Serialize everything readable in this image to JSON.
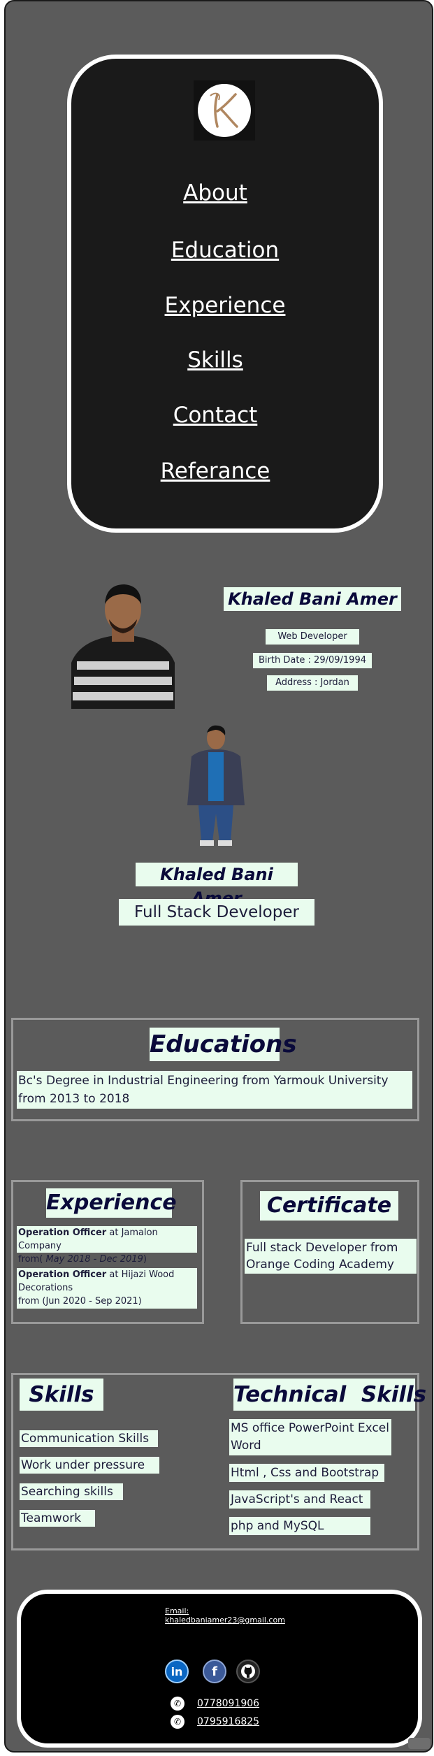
{
  "nav": {
    "items": [
      {
        "label": "About"
      },
      {
        "label": "Education"
      },
      {
        "label": "Experience"
      },
      {
        "label": "Skills"
      },
      {
        "label": "Contact"
      },
      {
        "label": "Referance"
      }
    ]
  },
  "profile": {
    "name": "Khaled Bani Amer",
    "title": "Web Developer",
    "birth": "Birth Date : 29/09/1994",
    "address": "Address : Jordan"
  },
  "hero": {
    "name": "Khaled Bani Amer",
    "role": "Full Stack Developer"
  },
  "education": {
    "heading": "Educations",
    "text": "Bc's Degree in Industrial Engineering from Yarmouk University from 2013 to 2018"
  },
  "experience": {
    "heading": "Experience",
    "jobs": [
      {
        "role": "Operation Officer",
        "company": " at Jamalon Company",
        "dates_prefix": "from(",
        "dates": " May 2018 - Dec 2019",
        "dates_suffix": ")"
      },
      {
        "role": "Operation Officer",
        "company": " at Hijazi Wood Decorations",
        "dates_prefix": "from (Jun 2020 - Sep 2021)",
        "dates": "",
        "dates_suffix": ""
      }
    ]
  },
  "certificate": {
    "heading": "Certificate",
    "text": "Full stack Developer from Orange Coding Academy"
  },
  "skills": {
    "heading": "Skills",
    "items": [
      "Communication Skills",
      "Work under pressure",
      "Searching skills",
      "Teamwork"
    ]
  },
  "technical": {
    "heading": "Technical  Skills",
    "items": [
      "MS office PowerPoint Excel Word",
      "Html , Css and Bootstrap",
      "JavaScript's and React",
      "php and MySQL"
    ]
  },
  "contact": {
    "email_label": "Email:",
    "email": "khaledbaniamer23@gmail.com",
    "phones": [
      "0778091906",
      "0795916825"
    ],
    "social": [
      {
        "icon": "linkedin-icon",
        "glyph": "in",
        "color": "#0a66c2"
      },
      {
        "icon": "facebook-icon",
        "glyph": "f",
        "color": "#3b5998"
      },
      {
        "icon": "github-icon",
        "glyph": "◉",
        "color": "#222222"
      }
    ]
  },
  "colors": {
    "page_bg": "#5b5b5b",
    "card_bg": "#1a1a1a",
    "label_bg": "#e9fcee",
    "heading_text": "#0a0a3a"
  }
}
